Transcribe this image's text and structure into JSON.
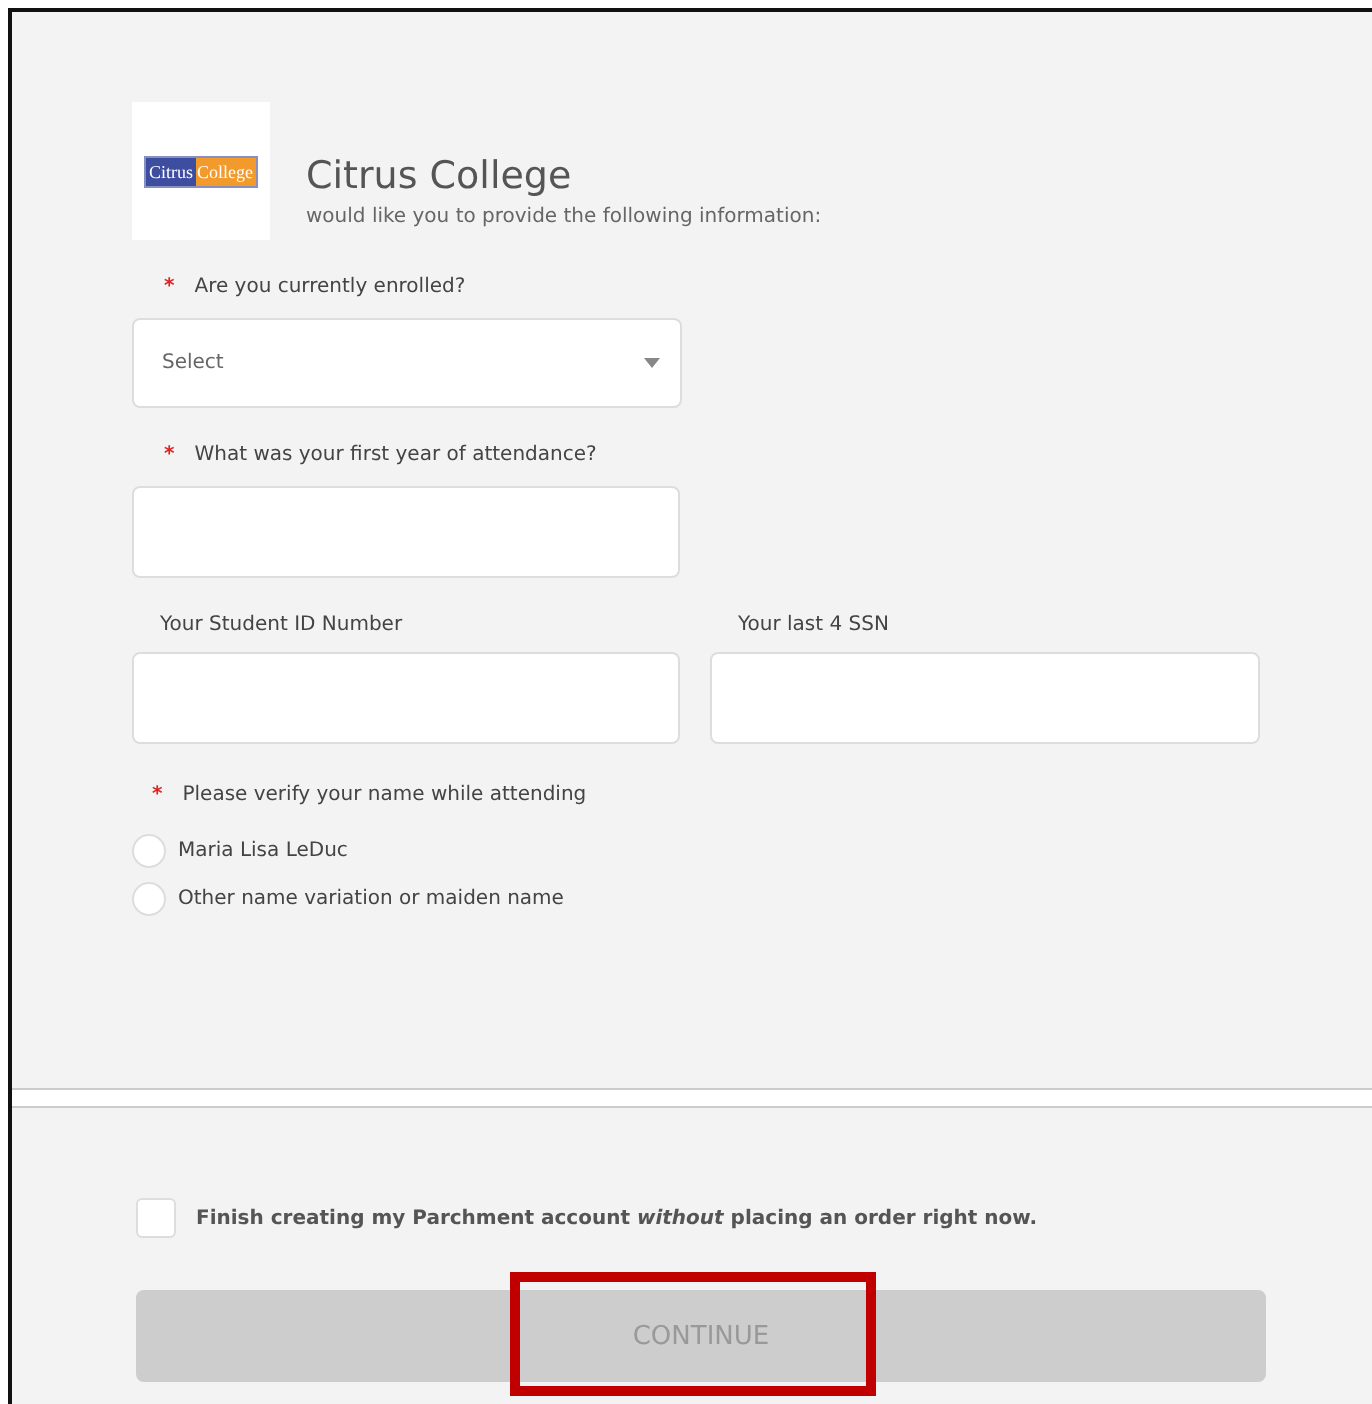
{
  "school": {
    "logo_left": "Citrus",
    "logo_right": "College",
    "name": "Citrus College",
    "subtitle": "would like you to provide the following information:"
  },
  "enrolled": {
    "required_mark": "*",
    "label": "Are you currently enrolled?",
    "placeholder": "Select"
  },
  "first_year": {
    "required_mark": "*",
    "label": "What was your first year of attendance?"
  },
  "id_fields": [
    {
      "label": "Your Student ID Number"
    },
    {
      "label": "Your last 4 SSN"
    }
  ],
  "name_verify": {
    "required_mark": "*",
    "label": "Please verify your name while attending",
    "options": [
      {
        "label": "Maria Lisa LeDuc",
        "selected": false
      },
      {
        "label": "Other name variation or maiden name",
        "selected": false
      }
    ]
  },
  "finish_option": {
    "text": "Finish creating my Parchment account *without* placing an order right now.",
    "checked": false
  },
  "continue_button": {
    "label": "CONTINUE",
    "disabled": true,
    "highlighted": true
  }
}
